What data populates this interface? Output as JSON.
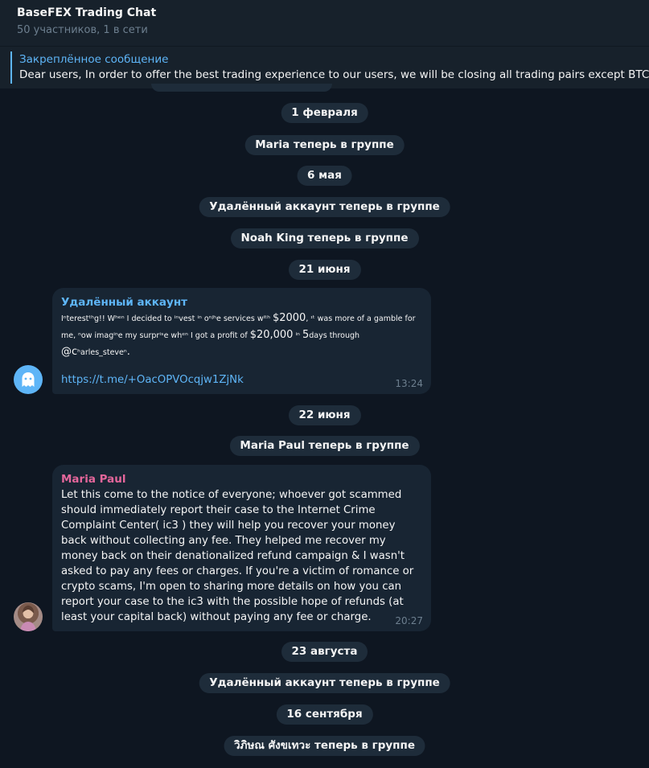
{
  "header": {
    "title": "BaseFEX Trading Chat",
    "subtitle": "50 участников, 1 в сети"
  },
  "pinned": {
    "label": "Закреплённое сообщение",
    "text": "Dear users,  In order to offer the best trading experience to our users, we will be closing all trading pairs except BTC/"
  },
  "services": {
    "date_feb1": "1 февраля",
    "maria_joined": "Maria теперь в группе",
    "date_may6": "6 мая",
    "deleted_joined_1": "Удалённый аккаунт теперь в группе",
    "noah_joined": "Noah King теперь в группе",
    "date_jun21": "21 июня",
    "date_jun22": "22 июня",
    "maria_paul_joined": "Maria Paul теперь в группе",
    "date_aug23": "23 августа",
    "deleted_joined_2": "Удалённый аккаунт теперь в группе",
    "date_sep16": "16 сентября",
    "thai_joined": "วิภิษณ ศังขเทวะ теперь в группе"
  },
  "messages": [
    {
      "sender": "Удалённый аккаунт",
      "sender_color": "#5eb5f7",
      "text_parts": [
        "Iⁿterestᵗʰg!! Wʰᵉⁿ I decided to ⁱⁿvest ⁱⁿ oⁿʲʰe services wⁱᵗʰ ",
        "$2000",
        ", ᶦᵗ was more of a gamble for me, ⁿow imagⁱⁿe my surprⁱˢe whᵉⁿ I got a profit of ",
        "$20,000",
        " ⁱⁿ ",
        "5",
        "days through ",
        "@c",
        "ʰarles_steveⁿ",
        "."
      ],
      "link": "https://t.me/+OacOPVOcqjw1ZjNk",
      "time": "13:24",
      "avatar": "ghost-icon"
    },
    {
      "sender": "Maria Paul",
      "sender_color": "#e4669b",
      "text": "Let this come to the notice of everyone; whoever got scammed should immediately report their case to the Internet Crime Complaint Center( ic3 ) they will help you recover your money back without collecting any fee. They helped me recover my money back on their denationalized refund campaign & I wasn't asked to pay any fees or charges. If you're a victim of romance or crypto scams, I'm open to sharing more details on how you can report your case to the ic3 with the possible hope of refunds (at least your capital back) without paying any fee or charge.",
      "time": "20:27",
      "avatar": "user-photo"
    }
  ],
  "colors": {
    "background": "#0e1621",
    "header": "#17212b",
    "bubble": "#182533",
    "service_pill": "#1e2c3a",
    "accent": "#5eb5f7",
    "muted": "#6d7f8f"
  }
}
